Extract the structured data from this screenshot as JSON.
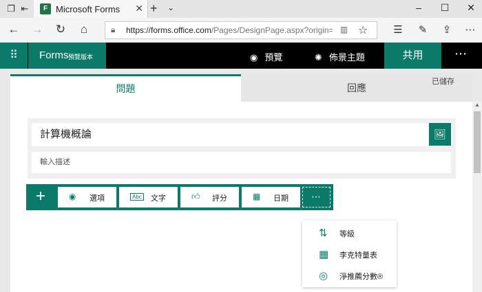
{
  "browser": {
    "tab_title": "Microsoft Forms",
    "tab_logo": "F",
    "url_domain": "https://forms.office.com",
    "url_path": "/Pages/DesignPage.aspx?origin=shell&auth"
  },
  "app": {
    "brand": "Forms",
    "brand_tag": "預覽版本",
    "preview_label": "預覽",
    "theme_label": "佈景主題",
    "share_label": "共用"
  },
  "tabs": {
    "questions": "問題",
    "responses": "回應"
  },
  "status": {
    "saved": "已儲存"
  },
  "form": {
    "title": "計算機概論",
    "description_placeholder": "輸入描述"
  },
  "question_types": {
    "choice": "選項",
    "text": "文字",
    "rating": "評分",
    "date": "日期"
  },
  "more_menu": {
    "ranking": "等級",
    "likert": "李克特量表",
    "nps": "淨推薦分數®"
  },
  "colors": {
    "accent": "#0b7a68",
    "header": "#000000"
  }
}
